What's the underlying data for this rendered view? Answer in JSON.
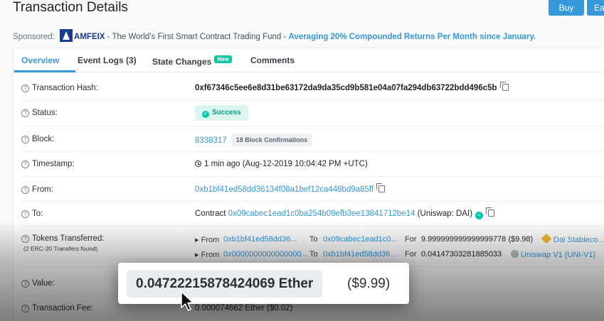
{
  "page": {
    "title": "Transaction Details",
    "buttons": {
      "buy": "Buy ▾",
      "earn": "Ear"
    }
  },
  "sponsored": {
    "label": "Sponsored:",
    "brand": "AMFEIX",
    "description": " - The World's First Smart Contract Trading Fund - ",
    "promo": "Averaging 20% Compounded Returns Per Month since January."
  },
  "tabs": {
    "overview": "Overview",
    "event_logs": "Event Logs (3)",
    "state_changes": "State Changes",
    "new_badge": "New",
    "comments": "Comments"
  },
  "rows": {
    "tx_hash": {
      "label": "Transaction Hash:",
      "value": "0xf67346c5ee6e8d31be63172da9da35cd9b581e04a07fa294db63722bdd496c5b"
    },
    "status": {
      "label": "Status:",
      "value": "Success"
    },
    "block": {
      "label": "Block:",
      "number": "8338317",
      "confirmations": "18 Block Confirmations"
    },
    "timestamp": {
      "label": "Timestamp:",
      "value": "1 min ago (Aug-12-2019 10:04:42 PM +UTC)"
    },
    "from": {
      "label": "From:",
      "value": "0xb1bf41ed58dd36134f08a1bef12ca448bd9a85ff"
    },
    "to": {
      "label": "To:",
      "prefix": "Contract",
      "address": "0x09cabec1ead1c0ba254b09efb3ee13841712be14",
      "name": "(Uniswap: DAI)"
    },
    "tokens": {
      "label": "Tokens Transferred:",
      "sublabel": "(2 ERC-20 Transfers found)",
      "transfers": [
        {
          "from_k": "▸ From",
          "from": "0xb1bf41ed58dd36...",
          "to_k": "To",
          "to": "0x09cabec1ead1c0...",
          "for_k": "For",
          "amount": "9.999999999999999778 ($9.98)",
          "token": "Dai Stableco..."
        },
        {
          "from_k": "▸ From",
          "from": "0x0000000000000000...",
          "to_k": "To",
          "to": "0xb1bf41ed58dd36...",
          "for_k": "For",
          "amount": "0.04147303281885033",
          "token": "Uniswap V1 (UNI-V1)"
        }
      ]
    },
    "value": {
      "label": "Value:"
    },
    "fee": {
      "label": "Transaction Fee:",
      "value": "0.000074662 Ether ($0.02)"
    }
  },
  "zoom": {
    "ether": "0.04722215878424069 Ether",
    "usd": "($9.99)"
  },
  "colors": {
    "accent": "#3498db",
    "success": "#00c9a7",
    "brand": "#1a3a8c"
  }
}
